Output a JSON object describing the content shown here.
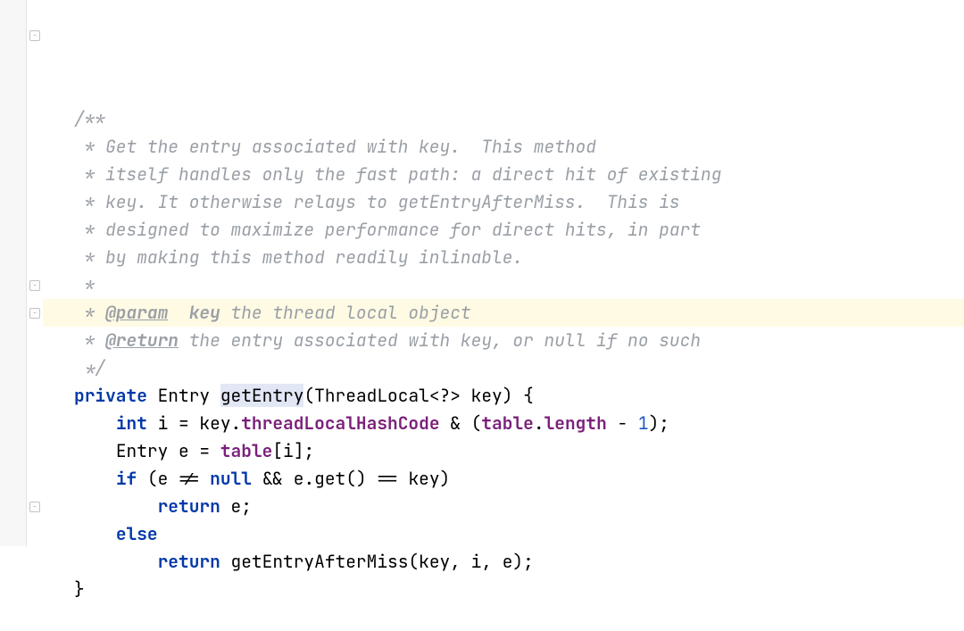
{
  "comment": {
    "open": "/**",
    "l1": " * Get the entry associated with key.  This method",
    "l2": " * itself handles only the fast path: a direct hit of existing",
    "l3": " * key. It otherwise relays to getEntryAfterMiss.  This is",
    "l4": " * designed to maximize performance for direct hits, in part",
    "l5": " * by making this method readily inlinable.",
    "l6": " *",
    "l7a": " * ",
    "paramTag": "@param",
    "paramName": "key",
    "l7b": " the thread local object",
    "l8a": " * ",
    "returnTag": "@return",
    "l8b": " the entry associated with key, or null if no such",
    "close": " */"
  },
  "code": {
    "kw_private": "private",
    "type_Entry": "Entry",
    "method": "getEntry",
    "sig_rest": "(ThreadLocal<?> key) {",
    "kw_int": "int",
    "i_decl": " i = key.",
    "fld1": "threadLocalHashCode",
    "amp": " & (",
    "fld2": "table",
    "dot": ".",
    "fld3": "length",
    "minus": " - ",
    "one": "1",
    "close_paren": ");",
    "e_decl_a": "Entry e = ",
    "fld4": "table",
    "e_decl_b": "[i];",
    "kw_if": "if",
    "if_cond_a": " (e != ",
    "kw_null": "null",
    "if_cond_b": " && e.get() == key)",
    "kw_return1": "return",
    "ret_e": " e;",
    "kw_else": "else",
    "kw_return2": "return",
    "ret_call": " getEntryAfterMiss(key, i, e);",
    "brace": "}"
  },
  "fold": {
    "minus": "−"
  },
  "colors": {
    "highlight": "#fffae3"
  }
}
